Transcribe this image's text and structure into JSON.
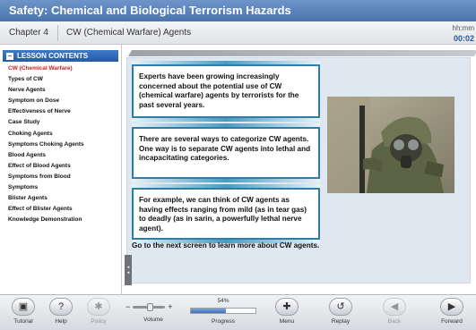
{
  "course_title": "Safety: Chemical and Biological Terrorism Hazards",
  "chapter": {
    "label": "Chapter 4",
    "title": "CW (Chemical Warfare) Agents",
    "time_label": "hh:mm",
    "time_value": "00:02"
  },
  "sidebar": {
    "header": "LESSON CONTENTS",
    "items": [
      {
        "label": "CW (Chemical Warfare)",
        "active": true
      },
      {
        "label": "Types of CW"
      },
      {
        "label": "Nerve Agents"
      },
      {
        "label": "Symptom on Dose"
      },
      {
        "label": "Effectiveness of Nerve"
      },
      {
        "label": "Case Study"
      },
      {
        "label": "Choking Agents"
      },
      {
        "label": "Symptoms Choking Agents"
      },
      {
        "label": "Blood Agents"
      },
      {
        "label": "Effect of Blood Agents"
      },
      {
        "label": "Symptoms from Blood"
      },
      {
        "label": "Symptoms"
      },
      {
        "label": "Blister Agents"
      },
      {
        "label": "Effect of Blister Agents"
      },
      {
        "label": "Knowledge Demonstration"
      }
    ]
  },
  "content": {
    "callouts": [
      "Experts have been growing increasingly concerned about the potential use of CW (chemical warfare) agents by terrorists for the past several years.",
      "There are several ways to categorize CW agents. One way is to separate CW agents into lethal and incapacitating categories.",
      "For example, we can think of CW agents as having effects ranging from mild (as in tear gas) to deadly (as in sarin, a powerfully lethal nerve agent)."
    ],
    "footer": "Go to the next screen to learn more about CW agents.",
    "image": "soldier-in-gas-mask"
  },
  "toolbar": {
    "tutorial": "Tutorial",
    "help": "Help",
    "policy": "Policy",
    "volume_label": "Volume",
    "progress_percent": "54%",
    "progress_value": 0.54,
    "progress_label": "Progress",
    "menu": "Menu",
    "replay": "Replay",
    "back": "Back",
    "forward": "Forward"
  },
  "colors": {
    "title_bar": "#4b74ac",
    "accent_blue": "#2c7ea8",
    "active_item": "#d41d1d"
  }
}
